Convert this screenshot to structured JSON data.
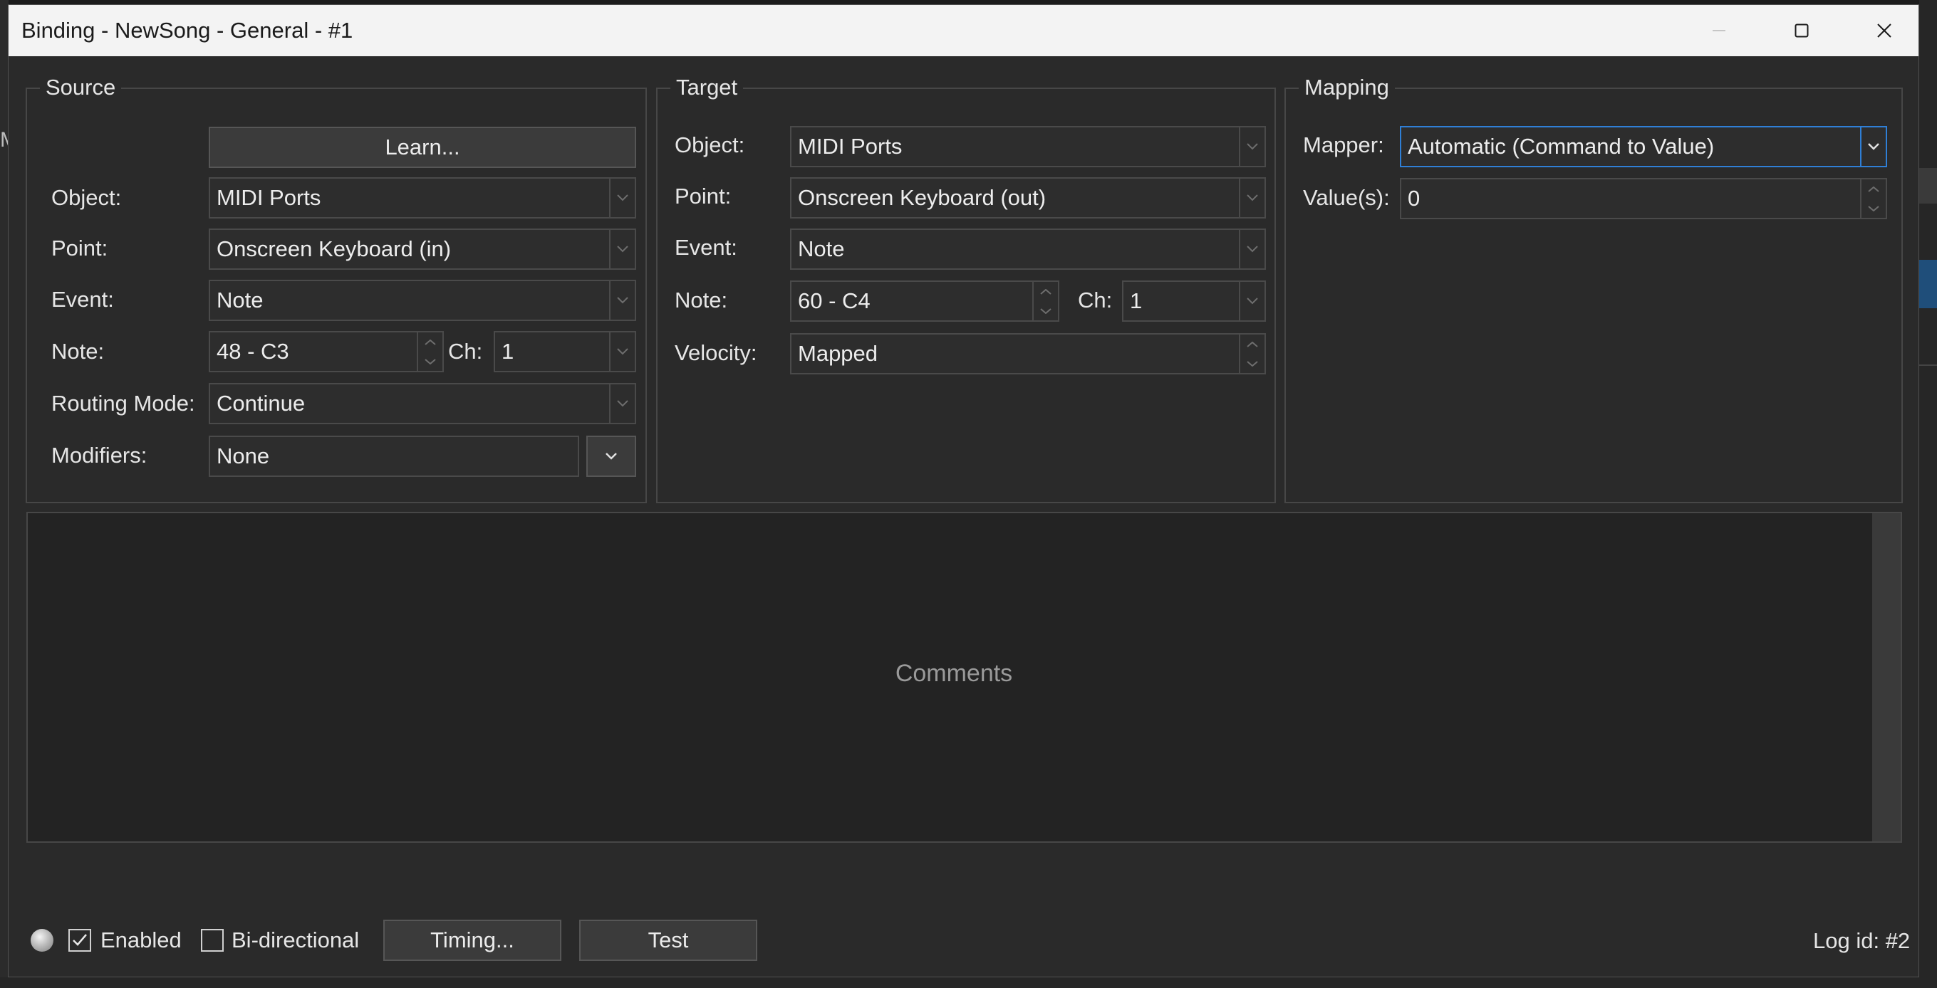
{
  "window": {
    "title": "Binding - NewSong - General - #1"
  },
  "background": {
    "left_edge_text": "M"
  },
  "source": {
    "group_title": "Source",
    "learn_button": "Learn...",
    "object_label": "Object:",
    "object_value": "MIDI Ports",
    "point_label": "Point:",
    "point_value": "Onscreen Keyboard (in)",
    "event_label": "Event:",
    "event_value": "Note",
    "note_label": "Note:",
    "note_value": "48 - C3",
    "channel_label": "Ch:",
    "channel_value": "1",
    "routing_label": "Routing Mode:",
    "routing_value": "Continue",
    "modifiers_label": "Modifiers:",
    "modifiers_value": "None"
  },
  "target": {
    "group_title": "Target",
    "object_label": "Object:",
    "object_value": "MIDI Ports",
    "point_label": "Point:",
    "point_value": "Onscreen Keyboard (out)",
    "event_label": "Event:",
    "event_value": "Note",
    "note_label": "Note:",
    "note_value": "60 - C4",
    "channel_label": "Ch:",
    "channel_value": "1",
    "velocity_label": "Velocity:",
    "velocity_value": "Mapped"
  },
  "mapping": {
    "group_title": "Mapping",
    "mapper_label": "Mapper:",
    "mapper_value": "Automatic (Command to Value)",
    "values_label": "Value(s):",
    "values_value": "0"
  },
  "comments": {
    "placeholder": "Comments"
  },
  "footer": {
    "enabled_label": "Enabled",
    "enabled_checked": true,
    "bidirectional_label": "Bi-directional",
    "bidirectional_checked": false,
    "timing_button": "Timing...",
    "test_button": "Test",
    "log_id": "Log id: #2"
  },
  "colors": {
    "window_bg": "#2a2a2a",
    "titlebar_bg": "#f3f3f3",
    "focus_accent": "#2f7fd6"
  }
}
